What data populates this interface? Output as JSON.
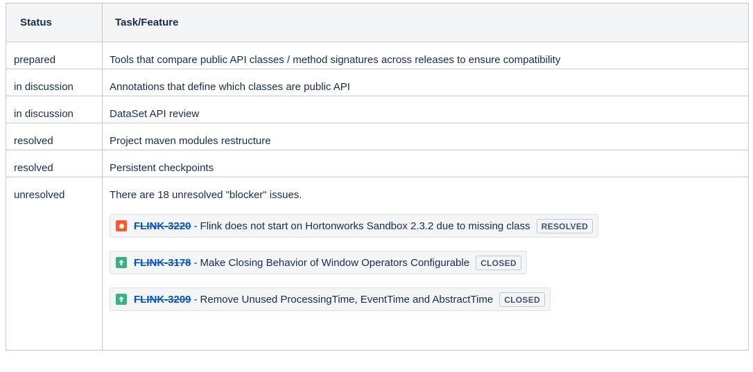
{
  "headers": {
    "status": "Status",
    "task": "Task/Feature"
  },
  "rows": [
    {
      "status": "prepared",
      "task": "Tools that compare public API classes / method signatures across releases to ensure compatibility"
    },
    {
      "status": "in discussion",
      "task": "Annotations that define which classes are public API"
    },
    {
      "status": "in discussion",
      "task": "DataSet API review"
    },
    {
      "status": "resolved",
      "task": "Project maven modules restructure"
    },
    {
      "status": "resolved",
      "task": "Persistent checkpoints"
    }
  ],
  "unresolved": {
    "status": "unresolved",
    "note": "There are 18 unresolved \"blocker\" issues.",
    "issues": [
      {
        "key": "FLINK-3220",
        "sep": "-",
        "summary": "Flink does not start on Hortonworks Sandbox 2.3.2 due to missing class",
        "badge": "RESOLVED",
        "icon": "blocker-priority-icon",
        "icon_color": "#ff5630"
      },
      {
        "key": "FLINK-3178",
        "sep": "-",
        "summary": "Make Closing Behavior of Window Operators Configurable",
        "badge": "CLOSED",
        "icon": "improvement-arrow-up-icon",
        "icon_color": "#36b37e"
      },
      {
        "key": "FLINK-3209",
        "sep": "-",
        "summary": "Remove Unused ProcessingTime, EventTime and AbstractTime",
        "badge": "CLOSED",
        "icon": "improvement-arrow-up-icon",
        "icon_color": "#36b37e"
      }
    ]
  }
}
